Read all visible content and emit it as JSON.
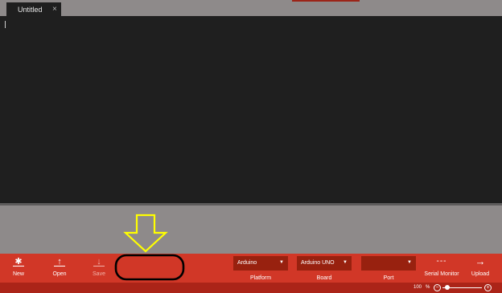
{
  "tabs": [
    {
      "label": "Untitled",
      "close_icon": "close-icon"
    }
  ],
  "toolbar": {
    "buttons": [
      {
        "label": "New",
        "icon": "asterisk-icon"
      },
      {
        "label": "Open",
        "icon": "upload-arrow-icon"
      },
      {
        "label": "Save",
        "icon": "download-arrow-icon"
      }
    ],
    "selects": [
      {
        "value": "Arduino",
        "label": "Platform"
      },
      {
        "value": "Arduino UNO",
        "label": "Board"
      },
      {
        "value": "",
        "label": "Port"
      }
    ],
    "serial_monitor": {
      "label": "Serial Monitor",
      "icon": "dashes-icon"
    },
    "upload": {
      "label": "Upload",
      "icon": "arrow-right-icon"
    }
  },
  "statusbar": {
    "zoom_value": "100",
    "zoom_unit": "%",
    "zoom_level": 0.08
  },
  "colors": {
    "toolbar": "#d13727",
    "select_bg": "#98210f",
    "editor_bg": "#1f1f1f",
    "annotation_arrow": "#ffff00",
    "annotation_ellipse": "#000000"
  }
}
